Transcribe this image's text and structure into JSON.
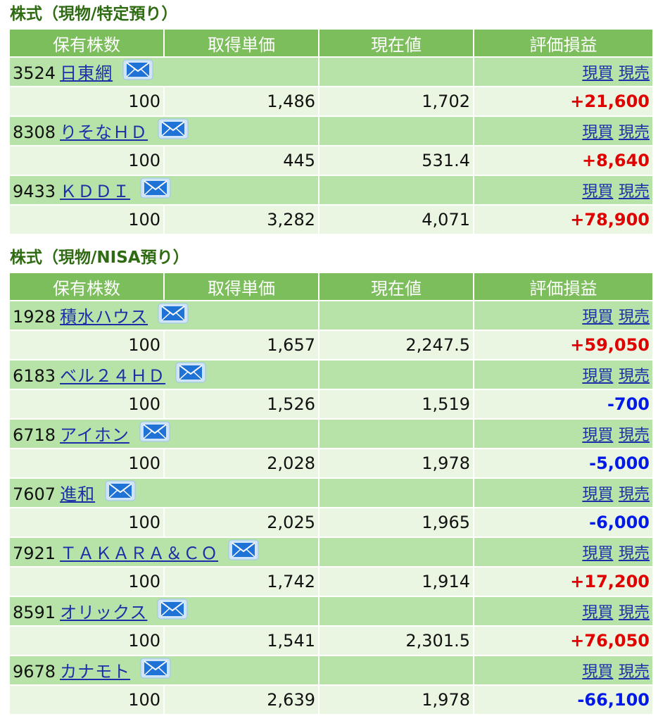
{
  "sections": [
    {
      "title": "株式（現物/特定預り）",
      "headers": [
        "保有株数",
        "取得単価",
        "現在値",
        "評価損益"
      ],
      "buy_label": "現買",
      "sell_label": "現売",
      "holdings": [
        {
          "code": "3524",
          "name": "日東網",
          "shares": "100",
          "cost": "1,486",
          "price": "1,702",
          "pl": "+21,600"
        },
        {
          "code": "8308",
          "name": "りそなＨＤ",
          "shares": "100",
          "cost": "445",
          "price": "531.4",
          "pl": "+8,640"
        },
        {
          "code": "9433",
          "name": "ＫＤＤＩ",
          "shares": "100",
          "cost": "3,282",
          "price": "4,071",
          "pl": "+78,900"
        }
      ]
    },
    {
      "title": "株式（現物/NISA預り）",
      "headers": [
        "保有株数",
        "取得単価",
        "現在値",
        "評価損益"
      ],
      "buy_label": "現買",
      "sell_label": "現売",
      "holdings": [
        {
          "code": "1928",
          "name": "積水ハウス",
          "shares": "100",
          "cost": "1,657",
          "price": "2,247.5",
          "pl": "+59,050"
        },
        {
          "code": "6183",
          "name": "ベル２４ＨＤ",
          "shares": "100",
          "cost": "1,526",
          "price": "1,519",
          "pl": "-700"
        },
        {
          "code": "6718",
          "name": "アイホン",
          "shares": "100",
          "cost": "2,028",
          "price": "1,978",
          "pl": "-5,000"
        },
        {
          "code": "7607",
          "name": "進和",
          "shares": "100",
          "cost": "2,025",
          "price": "1,965",
          "pl": "-6,000"
        },
        {
          "code": "7921",
          "name": "ＴＡＫＡＲＡ＆ＣＯ",
          "shares": "100",
          "cost": "1,742",
          "price": "1,914",
          "pl": "+17,200"
        },
        {
          "code": "8591",
          "name": "オリックス",
          "shares": "100",
          "cost": "1,541",
          "price": "2,301.5",
          "pl": "+76,050"
        },
        {
          "code": "9678",
          "name": "カナモト",
          "shares": "100",
          "cost": "2,639",
          "price": "1,978",
          "pl": "-66,100"
        }
      ]
    }
  ],
  "icons": {
    "mail": "mail-icon"
  },
  "colors": {
    "header_bg": "#7cbd5c",
    "name_row_bg": "#b7e3a8",
    "value_row_bg": "#eaf6e2",
    "title_green": "#2f6b12",
    "link_blue": "#1a2fa8",
    "gain_red": "#e00000",
    "loss_blue": "#0019e6"
  }
}
